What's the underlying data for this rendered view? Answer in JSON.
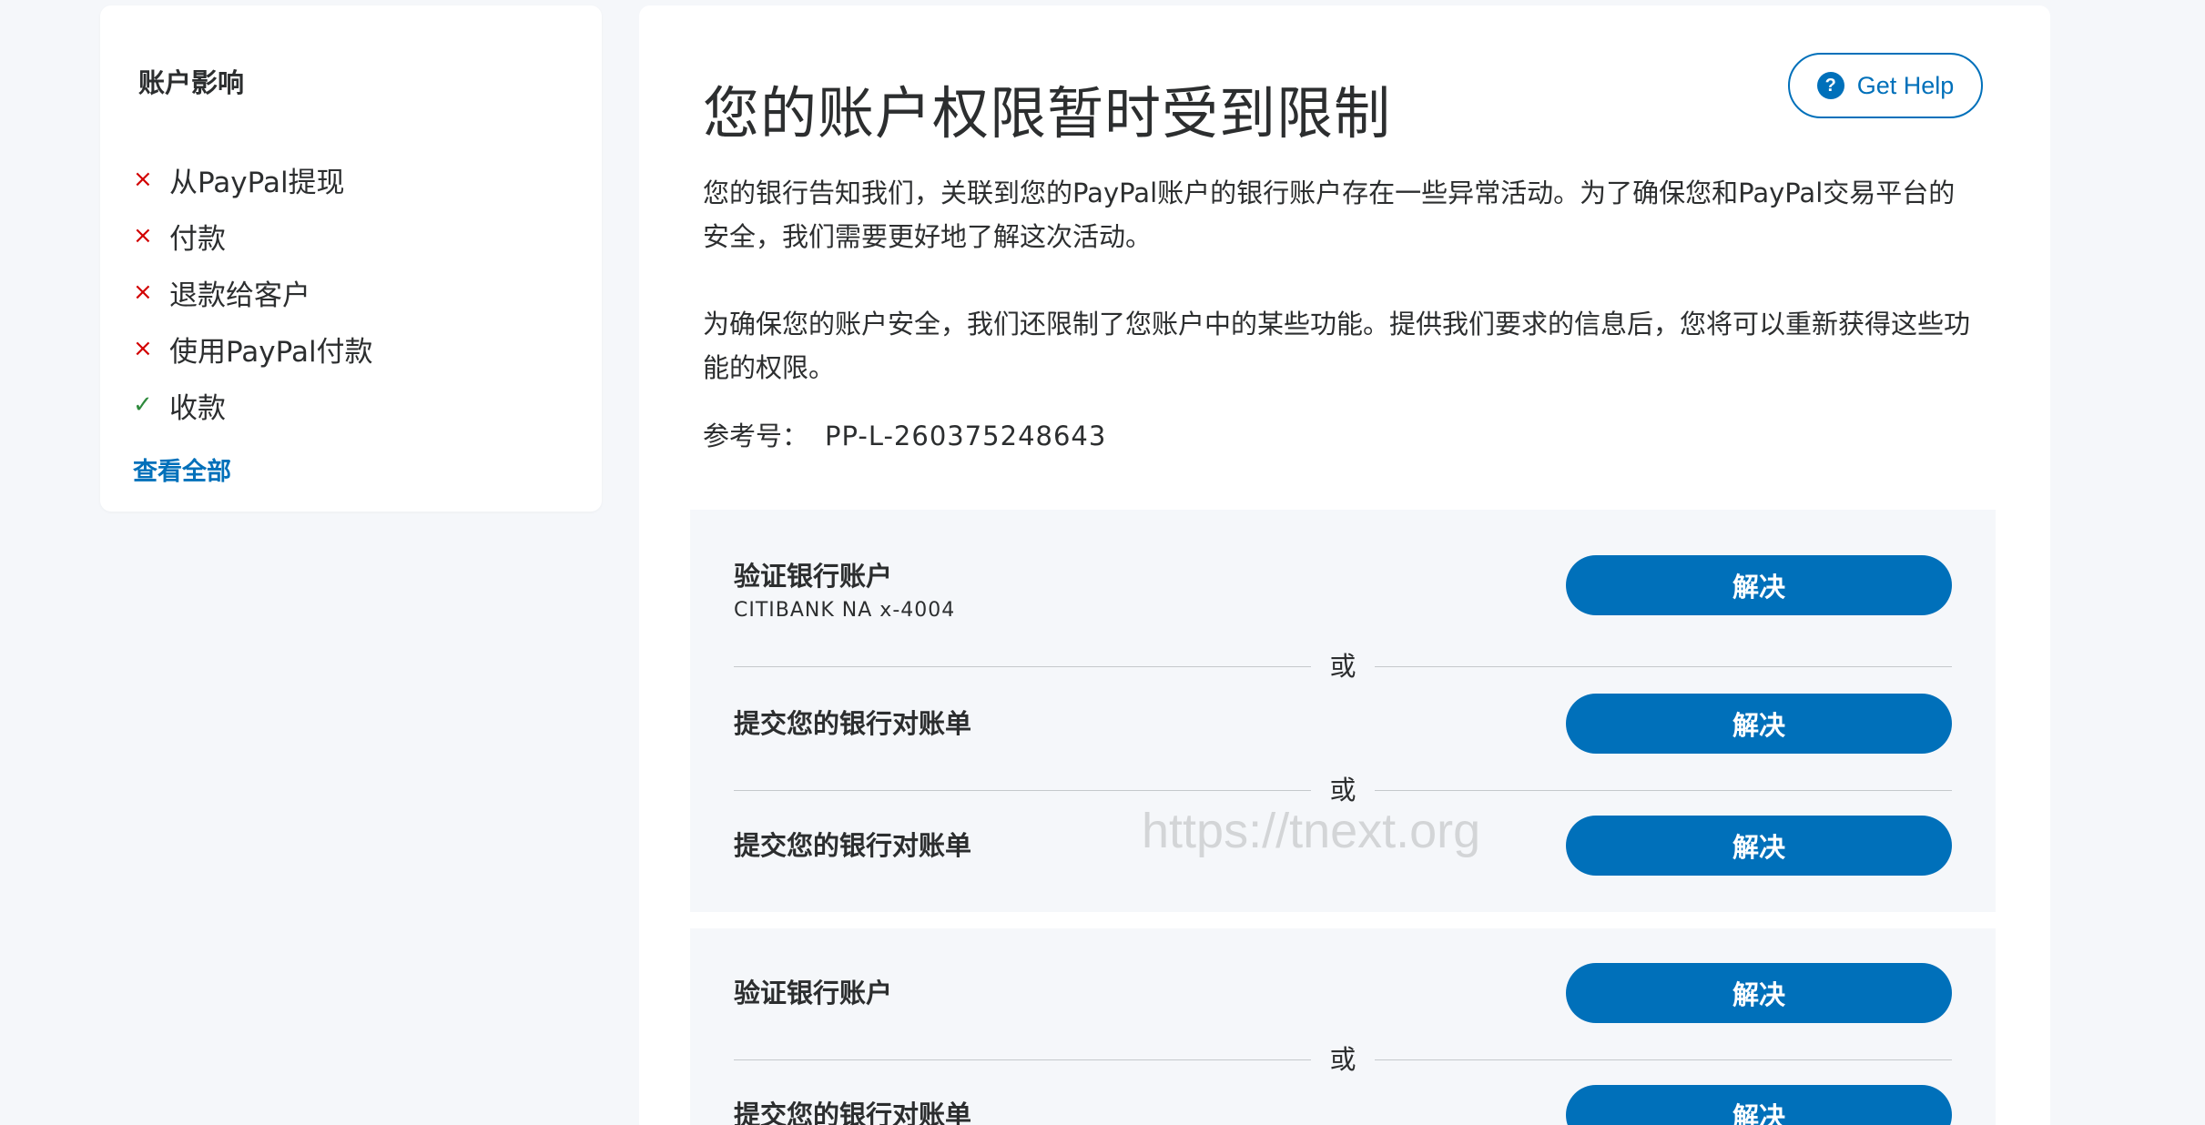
{
  "sidebar": {
    "title": "账户影响",
    "items": [
      {
        "label": "从PayPal提现",
        "mark": "×",
        "status": "restricted"
      },
      {
        "label": "付款",
        "mark": "×",
        "status": "restricted"
      },
      {
        "label": "退款给客户",
        "mark": "×",
        "status": "restricted"
      },
      {
        "label": "使用PayPal付款",
        "mark": "×",
        "status": "restricted"
      },
      {
        "label": "收款",
        "mark": "✓",
        "status": "allowed"
      }
    ],
    "view_all": "查看全部"
  },
  "main": {
    "title": "您的账户权限暂时受到限制",
    "help_label": "Get Help",
    "help_icon": "?",
    "paragraph1": "您的银行告知我们，关联到您的PayPal账户的银行账户存在一些异常活动。为了确保您和PayPal交易平台的安全，我们需要更好地了解这次活动。",
    "paragraph2": "为确保您的账户安全，我们还限制了您账户中的某些功能。提供我们要求的信息后，您将可以重新获得这些功能的权限。",
    "reference_label": "参考号：",
    "reference_value": "PP-L-260375248643"
  },
  "panels": [
    {
      "options": [
        {
          "title": "验证银行账户",
          "subtitle": "CITIBANK NA x-4004",
          "button": "解决"
        },
        {
          "title": "提交您的银行对账单",
          "button": "解决"
        },
        {
          "title": "提交您的银行对账单",
          "button": "解决"
        }
      ],
      "separator": "或"
    },
    {
      "options": [
        {
          "title": "验证银行账户",
          "button": "解决"
        },
        {
          "title": "提交您的银行对账单",
          "button": "解决"
        }
      ],
      "separator": "或"
    }
  ],
  "watermark": "https://tnext.org",
  "colors": {
    "accent": "#0070ba",
    "restricted": "#d20000",
    "allowed": "#2e8a3c",
    "background": "#f5f7fa"
  }
}
